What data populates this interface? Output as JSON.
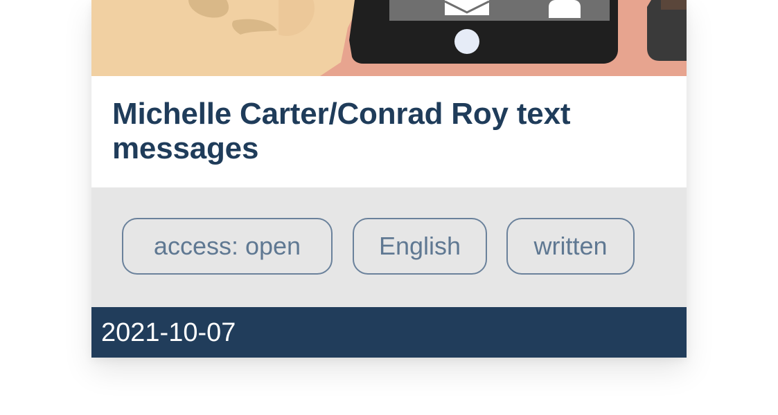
{
  "item": {
    "title": "Michelle Carter/Conrad Roy text messages",
    "tags": {
      "access": "access: open",
      "language": "English",
      "type": "written"
    },
    "date": "2021-10-07"
  },
  "colors": {
    "title": "#1f3c5a",
    "tag_border": "#6a819b",
    "tag_text": "#5f7892",
    "tag_band": "#e6e6e6",
    "footer": "#213d5b",
    "illustration_background": "#e7a48f",
    "phone": "#1f1f1f",
    "skin": "#f1d0a2"
  },
  "hero": {
    "icons": [
      "envelope-icon",
      "contact-person-icon",
      "home-button-icon"
    ]
  }
}
